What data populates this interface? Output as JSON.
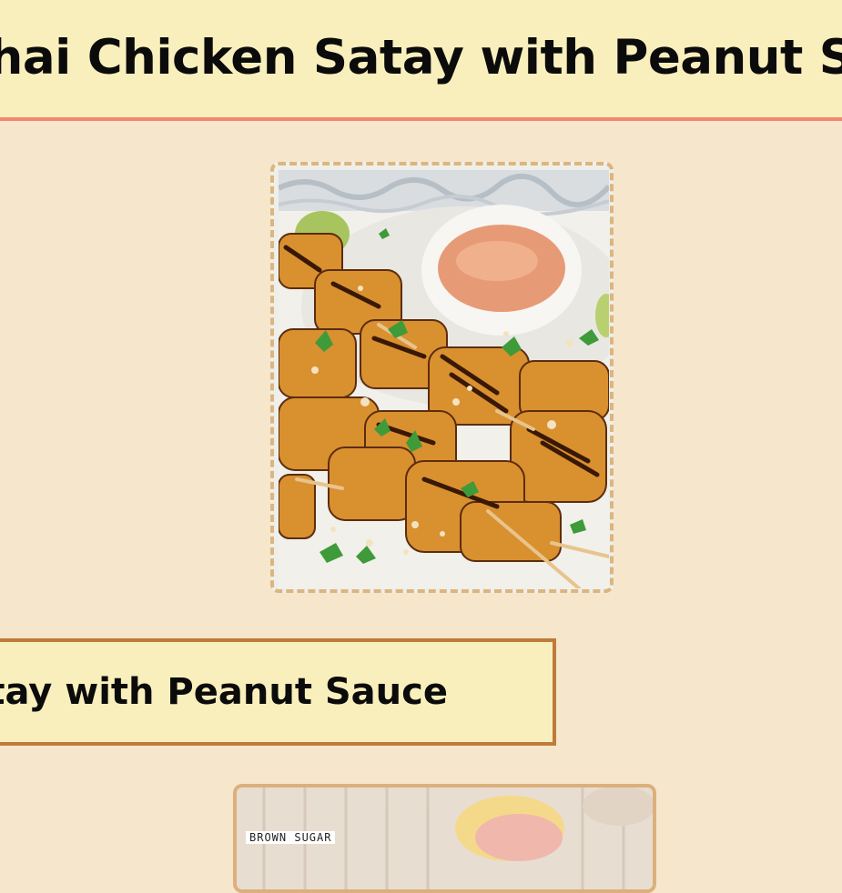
{
  "header": {
    "title": "Thai Chicken Satay with Peanut Sauce"
  },
  "hero": {
    "image_icon": "chicken-satay-photo",
    "accent_color": "#dcb57f"
  },
  "recipe_card": {
    "title": "Chicken Satay with Peanut Sauce"
  },
  "next_card": {
    "image_icon": "ingredients-photo",
    "label": "BROWN SUGAR"
  },
  "colors": {
    "background": "#f6e6cc",
    "header_bg": "#f9efbd",
    "header_border": "#f38670",
    "box_border": "#c07a3a"
  }
}
